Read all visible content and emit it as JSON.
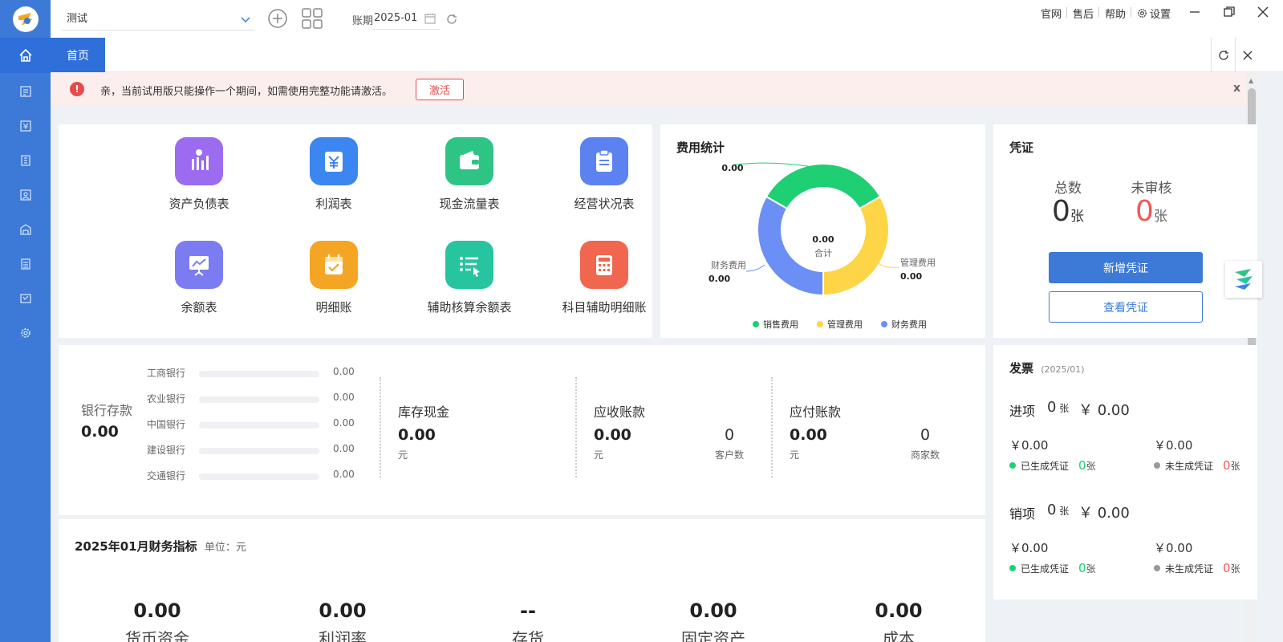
{
  "topbar": {
    "account_name": "测试",
    "period_label": "账期",
    "period_value": "2025-01",
    "links": [
      "官网",
      "售后",
      "帮助",
      "设置"
    ]
  },
  "tabs": {
    "home": "首页"
  },
  "notice": {
    "text": "亲，当前试用版只能操作一个期间，如需使用完整功能请激活。",
    "activate": "激活",
    "close": "x"
  },
  "reports": [
    {
      "label": "资产负债表",
      "icon": "balance-sheet-icon",
      "color": "#9b6cf0"
    },
    {
      "label": "利润表",
      "icon": "yen-document-icon",
      "color": "#3b86f0"
    },
    {
      "label": "现金流量表",
      "icon": "wallet-icon",
      "color": "#2ec486"
    },
    {
      "label": "经营状况表",
      "icon": "clipboard-icon",
      "color": "#5b82f0"
    },
    {
      "label": "余额表",
      "icon": "presentation-chart-icon",
      "color": "#7b7cf2"
    },
    {
      "label": "明细账",
      "icon": "calendar-check-icon",
      "color": "#f5a524"
    },
    {
      "label": "辅助核算余额表",
      "icon": "list-cursor-icon",
      "color": "#27c4a0"
    },
    {
      "label": "科目辅助明细账",
      "icon": "calculator-icon",
      "color": "#f0664e"
    }
  ],
  "expenses": {
    "title": "费用统计",
    "total_value": "0.00",
    "total_label": "合计",
    "slice_labels": [
      {
        "name": "",
        "value": "0.00"
      },
      {
        "name": "管理费用",
        "value": "0.00"
      },
      {
        "name": "财务费用",
        "value": "0.00"
      }
    ],
    "legend": [
      {
        "name": "销售费用",
        "color": "#1fcf73"
      },
      {
        "name": "管理费用",
        "color": "#fdd546"
      },
      {
        "name": "财务费用",
        "color": "#6b8ff5"
      }
    ]
  },
  "chart_data": {
    "type": "pie",
    "title": "费用统计",
    "categories": [
      "销售费用",
      "管理费用",
      "财务费用"
    ],
    "values": [
      0.0,
      0.0,
      0.0
    ],
    "center_value": "0.00",
    "center_label": "合计",
    "legend_position": "bottom"
  },
  "vouchers": {
    "title": "凭证",
    "total_label": "总数",
    "total_value": "0",
    "pending_label": "未审核",
    "pending_value": "0",
    "unit": "张",
    "new_button": "新增凭证",
    "view_button": "查看凭证",
    "pending_color": "#f05a5a"
  },
  "funds": {
    "bank_label": "银行存款",
    "bank_total": "0.00",
    "banks": [
      {
        "name": "工商银行",
        "value": "0.00"
      },
      {
        "name": "农业银行",
        "value": "0.00"
      },
      {
        "name": "中国银行",
        "value": "0.00"
      },
      {
        "name": "建设银行",
        "value": "0.00"
      },
      {
        "name": "交通银行",
        "value": "0.00"
      }
    ],
    "cash": {
      "title": "库存现金",
      "value": "0.00",
      "unit": "元"
    },
    "receivable": {
      "title": "应收账款",
      "value": "0.00",
      "unit": "元",
      "count": "0",
      "count_label": "客户数"
    },
    "payable": {
      "title": "应付账款",
      "value": "0.00",
      "unit": "元",
      "count": "0",
      "count_label": "商家数"
    }
  },
  "indicators": {
    "title": "2025年01月财务指标",
    "unit_label": "单位：元",
    "items": [
      {
        "value": "0.00",
        "label": "货币资金"
      },
      {
        "value": "0.00",
        "label": "利润率"
      },
      {
        "value": "--",
        "label": "存货"
      },
      {
        "value": "0.00",
        "label": "固定资产"
      },
      {
        "value": "0.00",
        "label": "成本"
      }
    ]
  },
  "invoices": {
    "title": "发票",
    "period": "(2025/01)",
    "unit": "张",
    "input": {
      "label": "进项",
      "count": "0",
      "amount": "￥ 0.00",
      "generated_amount": "￥0.00",
      "generated_label": "已生成凭证",
      "generated_count": "0",
      "pending_amount": "￥0.00",
      "pending_label": "未生成凭证",
      "pending_count": "0"
    },
    "output": {
      "label": "销项",
      "count": "0",
      "amount": "￥ 0.00",
      "generated_amount": "￥0.00",
      "generated_label": "已生成凭证",
      "generated_count": "0",
      "pending_amount": "￥0.00",
      "pending_label": "未生成凭证",
      "pending_count": "0"
    },
    "generated_color": "#1fcf73",
    "pending_color": "#999999",
    "pending_count_color": "#f05a5a"
  }
}
